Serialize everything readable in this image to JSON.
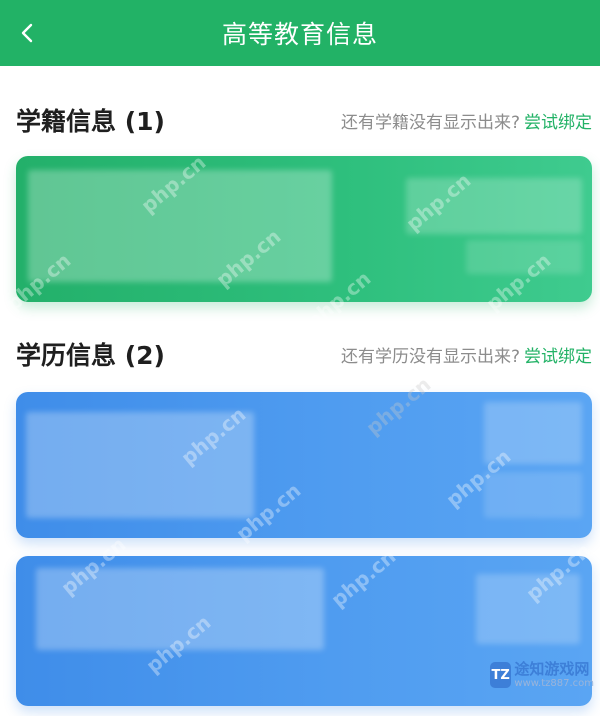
{
  "header": {
    "title": "高等教育信息"
  },
  "student_status": {
    "title": "学籍信息 (1)",
    "hint": "还有学籍没有显示出来?",
    "bind_label": "尝试绑定"
  },
  "education": {
    "title": "学历信息 (2)",
    "hint": "还有学历没有显示出来?",
    "bind_label": "尝试绑定"
  },
  "watermark": {
    "text": "php.cn"
  },
  "site_logo": {
    "mark": "TZ",
    "name": "途知游戏网",
    "url": "www.tz887.com"
  },
  "colors": {
    "brand_green": "#22b266",
    "card_green": "#2fc07e",
    "card_blue": "#4f9cf0"
  }
}
